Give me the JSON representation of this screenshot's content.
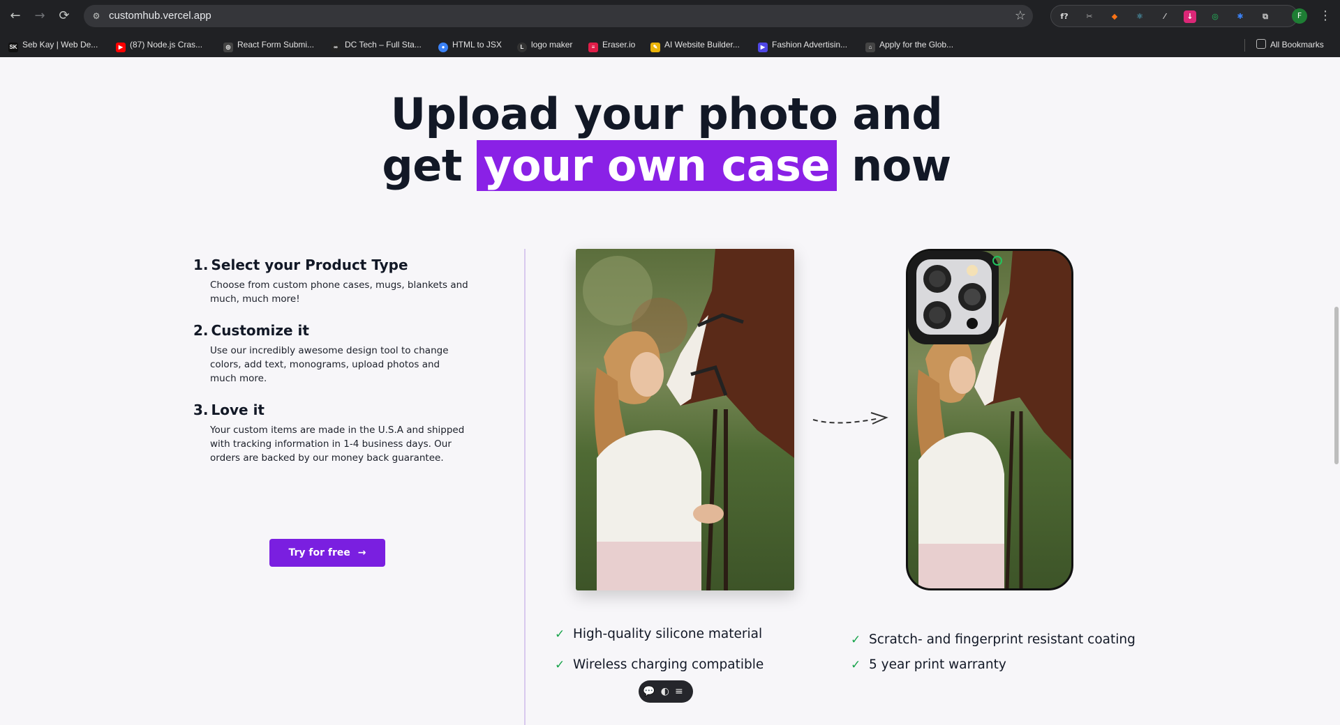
{
  "browser": {
    "url": "customhub.vercel.app",
    "profile_initial": "F",
    "nav": {
      "back": "←",
      "forward": "→",
      "reload": "⟳",
      "star": "☆",
      "menu": "⋮"
    },
    "extensions": [
      "f?",
      "✂",
      "◆",
      "⚛",
      "⁄",
      "↓",
      "◎",
      "✱",
      "⧉"
    ],
    "bookmarks": [
      {
        "label": "Seb Kay | Web De...",
        "icon": "SK",
        "color": "#111111"
      },
      {
        "label": "(87) Node.js Cras...",
        "icon": "▶",
        "color": "#ff0000"
      },
      {
        "label": "React Form Submi...",
        "icon": "◎",
        "color": "#444444"
      },
      {
        "label": "DC Tech – Full Sta...",
        "icon": "∞",
        "color": "#222222"
      },
      {
        "label": "HTML to JSX",
        "icon": "●",
        "color": "#3b82f6"
      },
      {
        "label": "logo maker",
        "icon": "L",
        "color": "#333333"
      },
      {
        "label": "Eraser.io",
        "icon": "≡",
        "color": "#e11d48"
      },
      {
        "label": "AI Website Builder...",
        "icon": "✎",
        "color": "#eab308"
      },
      {
        "label": "Fashion Advertisin...",
        "icon": "▶",
        "color": "#4f46e5"
      },
      {
        "label": "Apply for the Glob...",
        "icon": "⌂",
        "color": "#444444"
      }
    ],
    "all_bookmarks": "All Bookmarks"
  },
  "hero": {
    "line1": "Upload your photo and",
    "line2_before": "get ",
    "line2_highlight": "your own case",
    "line2_after": " now"
  },
  "steps": [
    {
      "number": "1.",
      "title": "Select your Product Type",
      "desc": "Choose from custom phone cases, mugs, blankets and much, much more!"
    },
    {
      "number": "2.",
      "title": "Customize it",
      "desc": "Use our incredibly awesome design tool to change colors, add text, monograms, upload photos and much more."
    },
    {
      "number": "3.",
      "title": "Love it",
      "desc": "Your custom items are made in the U.S.A and shipped with tracking information in 1-4 business days. Our orders are backed by our money back guarantee."
    }
  ],
  "cta": {
    "label": "Try for free",
    "arrow": "→"
  },
  "features_left": [
    "High-quality silicone material",
    "Wireless charging compatible"
  ],
  "features_right": [
    "Scratch- and fingerprint resistant coating",
    "5 year print warranty"
  ],
  "check_icon": "✓",
  "toolbar_float": "💬◐≡",
  "colors": {
    "accent": "#7a1fe0",
    "highlight": "#8a21e6",
    "check": "#16a34a"
  }
}
